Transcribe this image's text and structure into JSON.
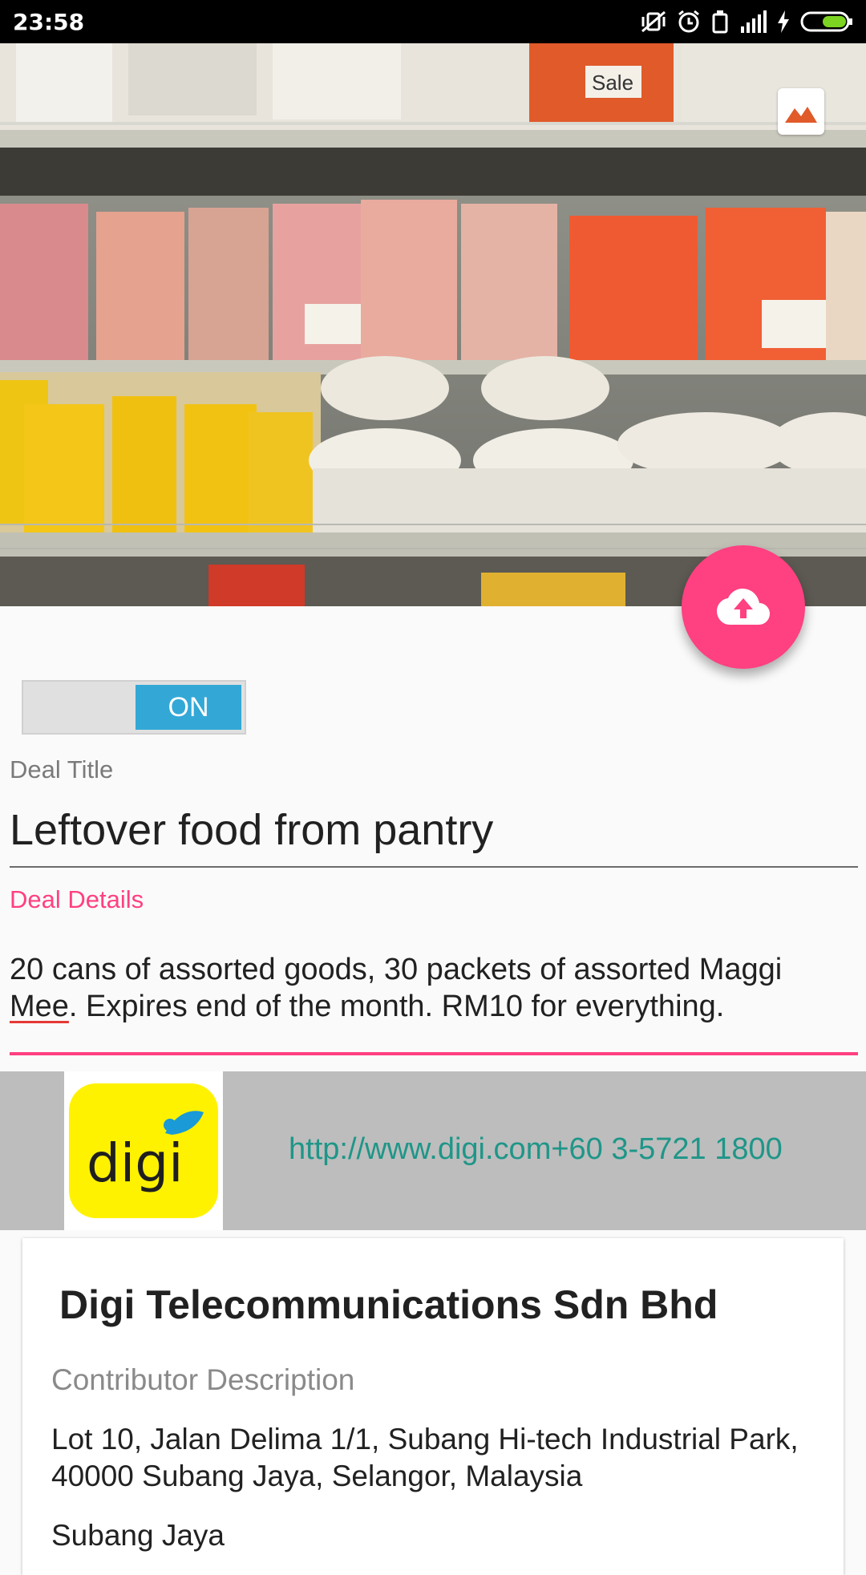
{
  "status_bar": {
    "time": "23:58",
    "icons": [
      "mute-vibrate-icon",
      "alarm-icon",
      "battery-saver-icon",
      "signal-icon",
      "charging-icon",
      "battery-icon"
    ]
  },
  "hero": {
    "description_icon": "image-picker-icon",
    "shelf_tag": "Sale"
  },
  "fab": {
    "icon": "cloud-upload-icon",
    "color": "#ff4081"
  },
  "toggle": {
    "label": "ON",
    "state": "on",
    "color": "#33a8d6"
  },
  "form": {
    "deal_title_label": "Deal Title",
    "deal_title_value": "Leftover food from pantry",
    "deal_details_label": "Deal Details",
    "deal_details_part1": "20 cans of assorted goods,  30 packets of assorted Maggi ",
    "deal_details_spell_word": "Mee",
    "deal_details_part2": ".  Expires end of the month.  RM10 for everything.",
    "accent_color": "#ff4081"
  },
  "sponsor": {
    "logo_text": "digi",
    "contact": "http://www.digi.com+60 3-5721 1800",
    "link_color": "#1e9688"
  },
  "contributor": {
    "name": "Digi Telecommunications Sdn Bhd",
    "description_label": "Contributor Description",
    "address": "Lot 10, Jalan Delima 1/1, Subang Hi-tech Industrial Park, 40000 Subang Jaya, Selangor, Malaysia",
    "city": "Subang Jaya"
  }
}
